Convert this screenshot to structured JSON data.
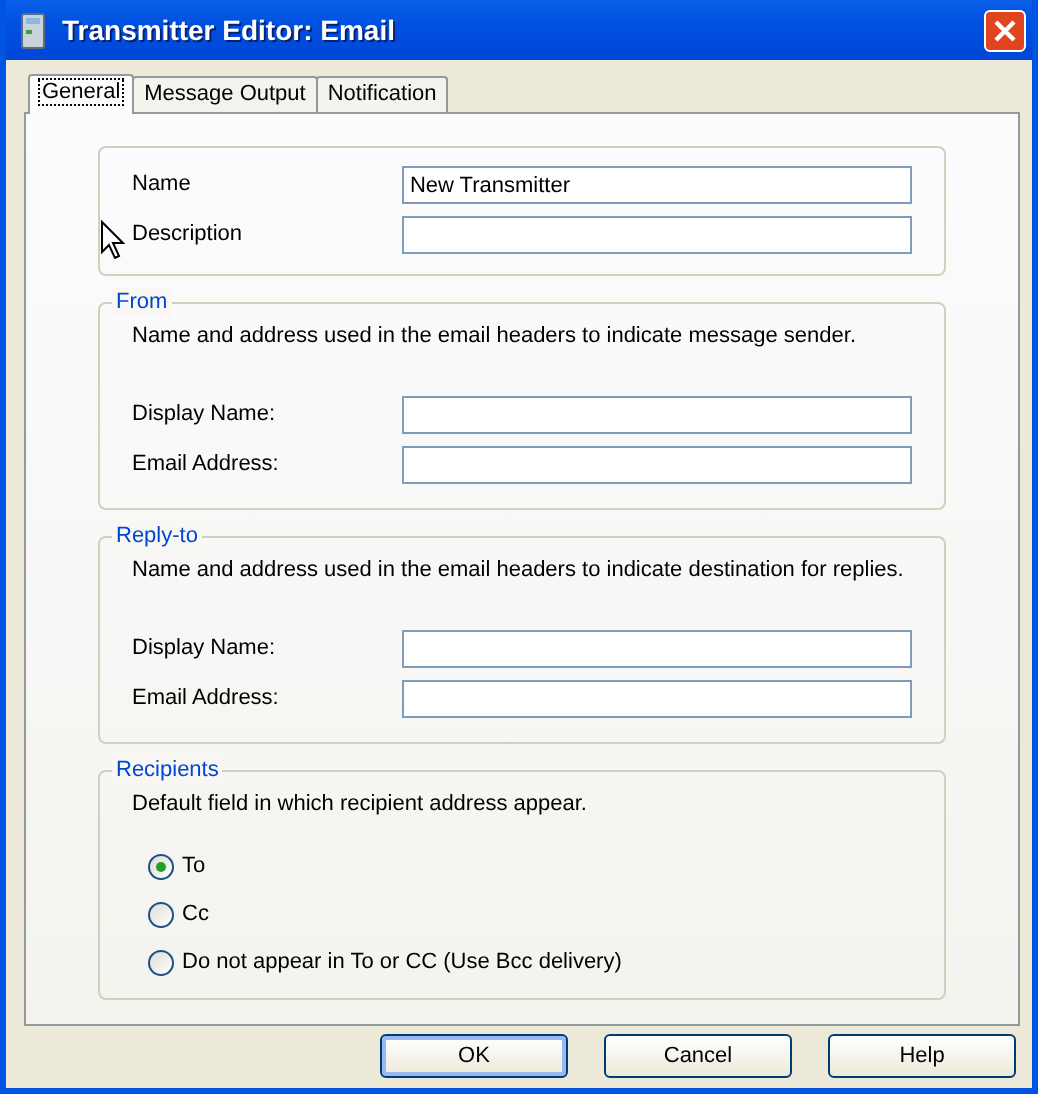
{
  "window": {
    "title": "Transmitter Editor: Email"
  },
  "tabs": [
    {
      "label": "General",
      "selected": true
    },
    {
      "label": "Message Output",
      "selected": false
    },
    {
      "label": "Notification",
      "selected": false
    }
  ],
  "groups": [
    {
      "fields": [
        {
          "label": "Name",
          "value": "New Transmitter"
        },
        {
          "label": "Description"
        }
      ]
    },
    {
      "legend": "From",
      "description": "Name and address used in the email headers to indicate message sender.",
      "fields": [
        {
          "label": "Display Name:"
        },
        {
          "label": "Email Address:"
        }
      ]
    },
    {
      "legend": "Reply-to",
      "description": "Name and address used in the email headers to indicate destination for replies.",
      "fields": [
        {
          "label": "Display Name:"
        },
        {
          "label": "Email Address:"
        }
      ]
    },
    {
      "legend": "Recipients",
      "description": "Default field in which recipient address appear.",
      "options": [
        {
          "label": "To",
          "selected": true
        },
        {
          "label": "Cc",
          "selected": false
        },
        {
          "label": "Do not appear in To or CC (Use Bcc delivery)",
          "selected": false
        }
      ]
    }
  ],
  "buttons": [
    {
      "label": "OK",
      "default": true
    },
    {
      "label": "Cancel",
      "default": false
    },
    {
      "label": "Help",
      "default": false
    }
  ]
}
